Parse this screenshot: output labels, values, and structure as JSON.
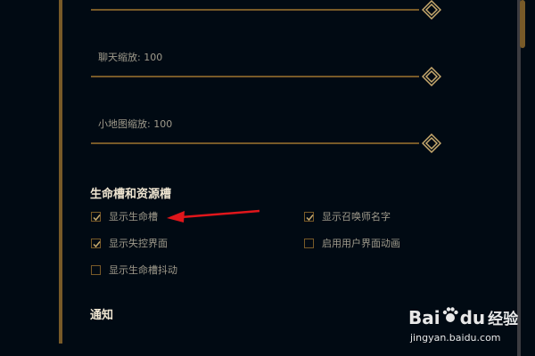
{
  "sliders": [
    {
      "label": "",
      "value_fraction": 1.0
    },
    {
      "label": "聊天缩放: 100",
      "value_fraction": 1.0
    },
    {
      "label": "小地图缩放: 100",
      "value_fraction": 1.0
    }
  ],
  "section_health": {
    "title": "生命槽和资源槽",
    "checkboxes": [
      {
        "label": "显示生命槽",
        "checked": true
      },
      {
        "label": "显示召唤师名字",
        "checked": true
      },
      {
        "label": "显示失控界面",
        "checked": true
      },
      {
        "label": "启用用户界面动画",
        "checked": false
      },
      {
        "label": "显示生命槽抖动",
        "checked": false
      }
    ]
  },
  "section_notify": {
    "title": "通知"
  },
  "watermark": {
    "brand_a": "Bai",
    "brand_b": "du",
    "brand_cn": "经验",
    "url": "jingyan.baidu.com"
  },
  "colors": {
    "background": "#010a13",
    "gold": "#785a28",
    "gold_light": "#c8aa6e",
    "text": "#a09b8c",
    "title": "#f0e6d2",
    "arrow": "#e0161b"
  }
}
